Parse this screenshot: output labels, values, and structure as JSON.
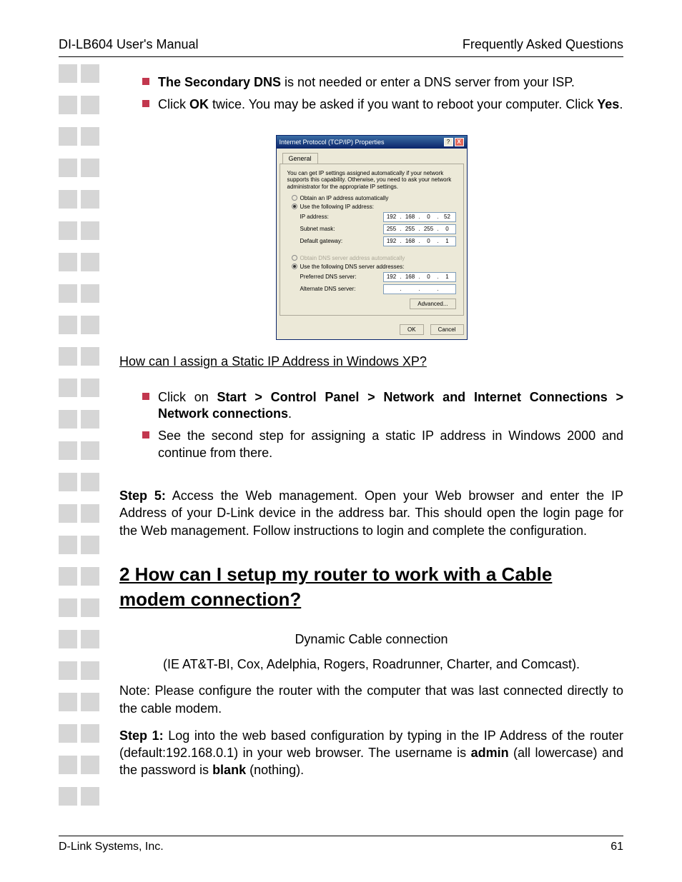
{
  "header": {
    "left": "DI-LB604 User's Manual",
    "right": "Frequently Asked Questions"
  },
  "bullets_top": [
    {
      "prefix": "",
      "bold1": "The Secondary DNS",
      "rest": " is not needed or enter a DNS server from your ISP."
    },
    {
      "prefix": "Click ",
      "bold1": "OK",
      "mid": " twice. You may be asked if you want to reboot your computer. Click ",
      "bold2": "Yes",
      "suffix": "."
    }
  ],
  "dialog": {
    "title": "Internet Protocol (TCP/IP) Properties",
    "tab": "General",
    "desc": "You can get IP settings assigned automatically if your network supports this capability. Otherwise, you need to ask your network administrator for the appropriate IP settings.",
    "radio_auto_ip": "Obtain an IP address automatically",
    "radio_use_ip": "Use the following IP address:",
    "ip_label": "IP address:",
    "ip_value": [
      "192",
      "168",
      "0",
      "52"
    ],
    "mask_label": "Subnet mask:",
    "mask_value": [
      "255",
      "255",
      "255",
      "0"
    ],
    "gw_label": "Default gateway:",
    "gw_value": [
      "192",
      "168",
      "0",
      "1"
    ],
    "radio_auto_dns": "Obtain DNS server address automatically",
    "radio_use_dns": "Use the following DNS server addresses:",
    "pdns_label": "Preferred DNS server:",
    "pdns_value": [
      "192",
      "168",
      "0",
      "1"
    ],
    "adns_label": "Alternate DNS server:",
    "adns_value": [
      "",
      "",
      "",
      ""
    ],
    "advanced": "Advanced...",
    "ok": "OK",
    "cancel": "Cancel"
  },
  "q_heading": "How can I assign a Static IP Address in Windows XP?",
  "bullets_mid": [
    {
      "prefix": "Click on ",
      "bold": "Start > Control Panel > Network and Internet Connections > Network connections",
      "suffix": "."
    },
    {
      "text": "See the second step for assigning a static IP address in Windows 2000 and continue from there."
    }
  ],
  "step5": {
    "label": "Step 5:",
    "text": " Access the Web management. Open your Web browser and enter the IP Address of your D-Link device in the address bar. This should open the login page for the Web management. Follow instructions to login and complete the configuration."
  },
  "big_heading": "2 How can I setup my router to work with a Cable modem connection?",
  "dyn_line": "Dynamic Cable connection",
  "isp_line": "(IE AT&T-BI, Cox, Adelphia, Rogers, Roadrunner, Charter, and Comcast).",
  "note_line": "Note: Please configure the router with the computer that was last connected directly to the cable modem.",
  "step1": {
    "label": "Step 1:",
    "t1": " Log into the web based configuration by typing in the IP Address of the router (default:192.168.0.1) in your web browser. The username is ",
    "b1": "admin",
    "t2": " (all lowercase) and the password is ",
    "b2": "blank",
    "t3": " (nothing)."
  },
  "footer": {
    "left": "D-Link Systems, Inc.",
    "right": "61"
  }
}
